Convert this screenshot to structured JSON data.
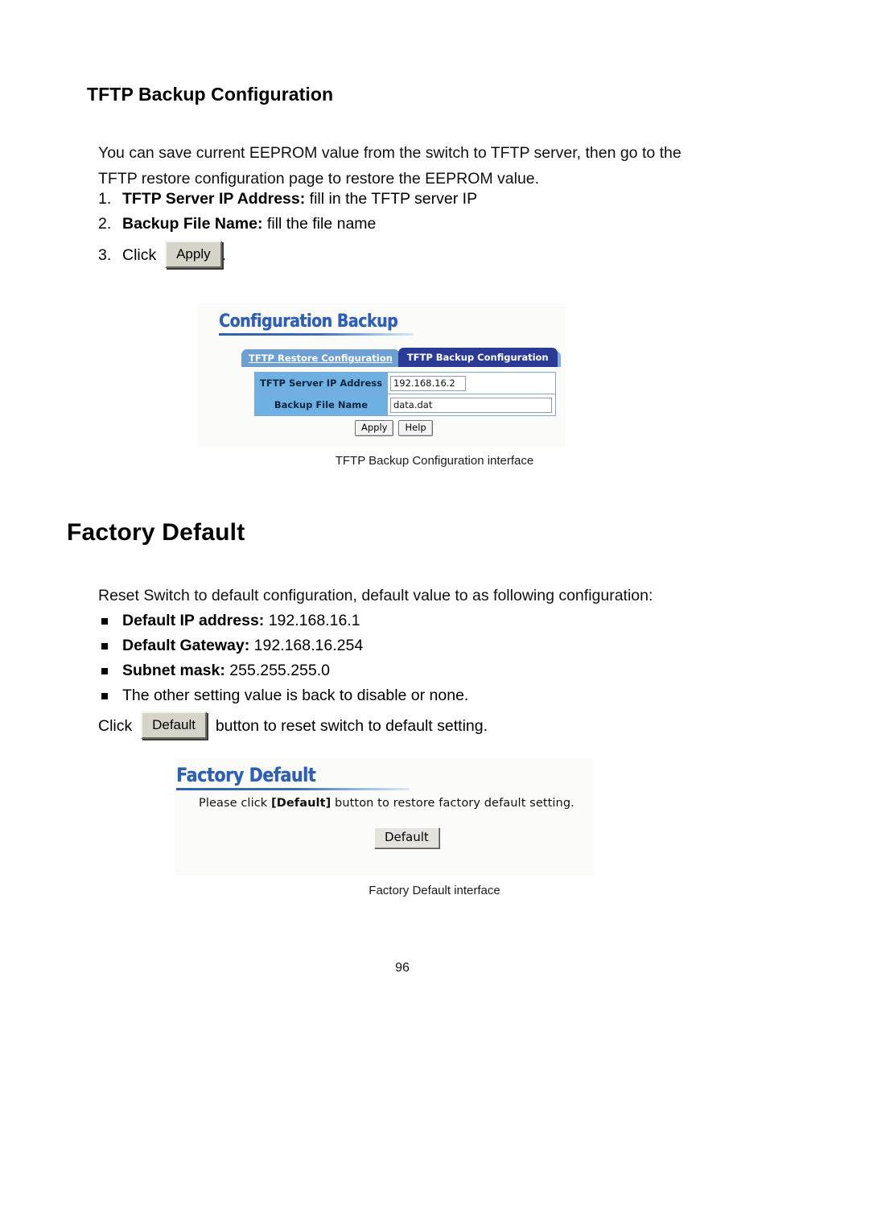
{
  "document": {
    "page_number": "96",
    "section_heading": "TFTP Backup Configuration",
    "chapter_heading": "Factory Default"
  },
  "tftp_backup": {
    "intro": "You can save current EEPROM value from the switch to TFTP server, then go to the TFTP restore configuration page to restore the EEPROM value.",
    "steps": [
      {
        "num": "1.",
        "bold": "TFTP Server IP Address:",
        "rest": " fill in the TFTP server IP"
      },
      {
        "num": "2.",
        "bold": "Backup File Name:",
        "rest": " fill the file name"
      }
    ],
    "click_step": {
      "num": "3.",
      "prefix": "Click",
      "button_label": "Apply",
      "suffix": "."
    },
    "caption": "TFTP Backup Configuration interface"
  },
  "backup_ui": {
    "title": "Configuration Backup",
    "tabs": [
      {
        "label": "TFTP Restore Configuration",
        "active": false
      },
      {
        "label": "TFTP Backup Configuration",
        "active": true
      }
    ],
    "fields": [
      {
        "label": "TFTP Server IP Address",
        "value": "192.168.16.2"
      },
      {
        "label": "Backup File Name",
        "value": "data.dat"
      }
    ],
    "buttons": [
      {
        "label": "Apply"
      },
      {
        "label": "Help"
      }
    ],
    "colors": {
      "title_blue": "#2f5fb0",
      "tab_active": "#2b3b95",
      "tab_inactive": "#6d9fd0",
      "label_cell": "#6fb0e2",
      "table_border": "#7fa8cf"
    }
  },
  "factory_default": {
    "intro": "Reset Switch to default configuration, default value to as following configuration:",
    "bullets": [
      {
        "bold": "Default IP address:",
        "rest": " 192.168.16.1"
      },
      {
        "bold": "Default Gateway:",
        "rest": " 192.168.16.254"
      },
      {
        "bold": "Subnet mask:",
        "rest": " 255.255.255.0"
      },
      {
        "bold": "",
        "rest": "The other setting value is back to disable or none."
      }
    ],
    "click_line": {
      "prefix": "Click",
      "button_label": "Default",
      "suffix": "button to reset switch to default setting."
    },
    "caption": "Factory Default interface"
  },
  "factory_ui": {
    "title": "Factory Default",
    "message_pre": "Please click ",
    "message_bold": "[Default]",
    "message_post": " button to restore factory default setting.",
    "button_label": "Default"
  }
}
